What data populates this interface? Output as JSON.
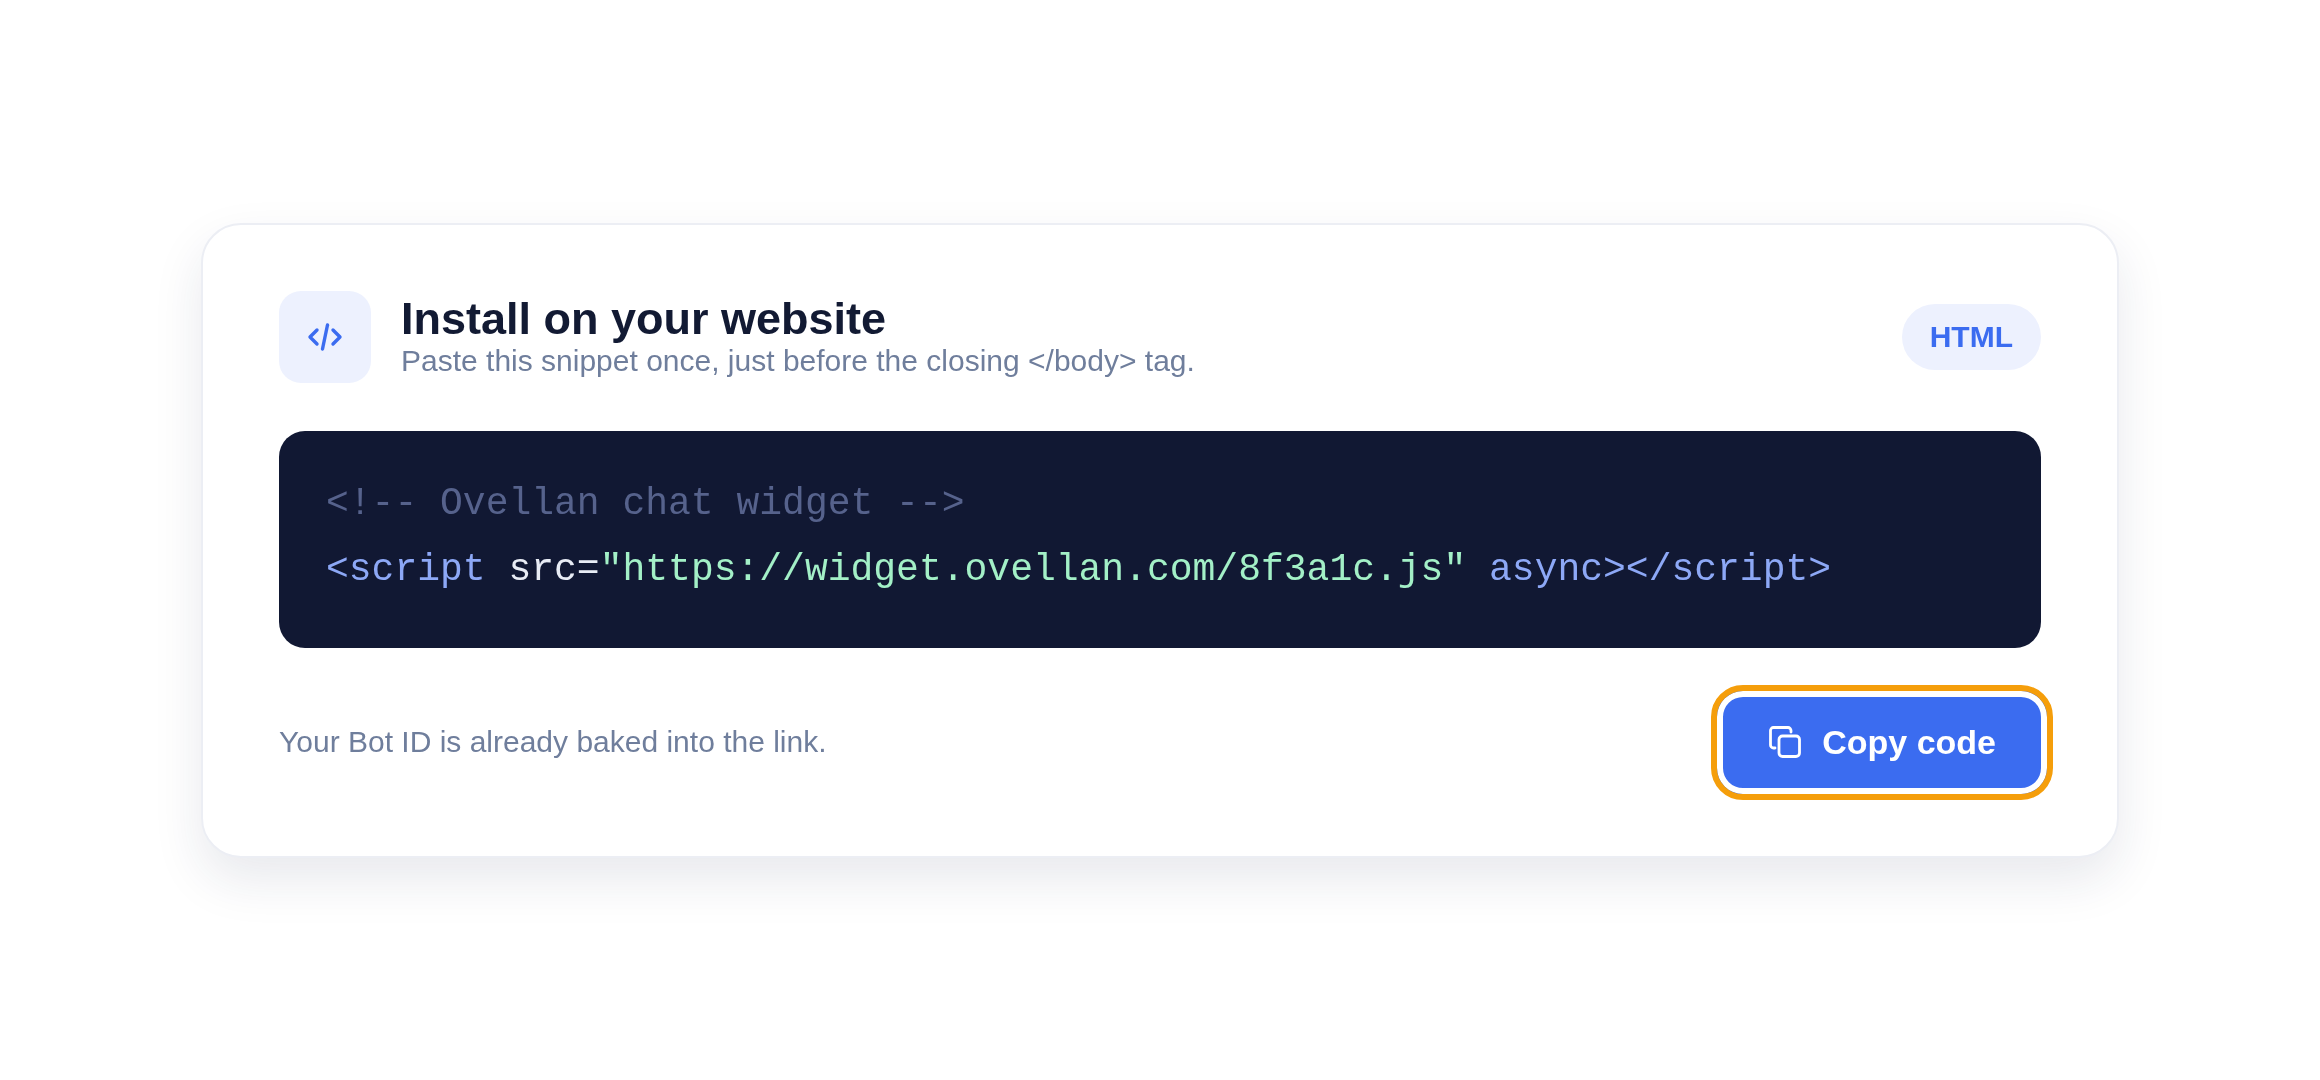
{
  "header": {
    "title": "Install on your website",
    "subtitle": "Paste this snippet once, just before the closing </body> tag.",
    "badge": "HTML"
  },
  "code_block": {
    "lines": [
      [
        {
          "kind": "comment",
          "text": "<!-- Ovellan chat widget -->"
        }
      ],
      [
        {
          "kind": "tag",
          "text": "<script"
        },
        {
          "kind": "plain",
          "text": " src="
        },
        {
          "kind": "string",
          "text": "\"https://widget.ovellan.com/8f3a1c.js\""
        },
        {
          "kind": "tag",
          "text": " async></script>"
        }
      ]
    ]
  },
  "footer": {
    "note": "Your Bot ID is already baked into the link.",
    "copy_button": {
      "label": "Copy code",
      "focused": true
    }
  }
}
